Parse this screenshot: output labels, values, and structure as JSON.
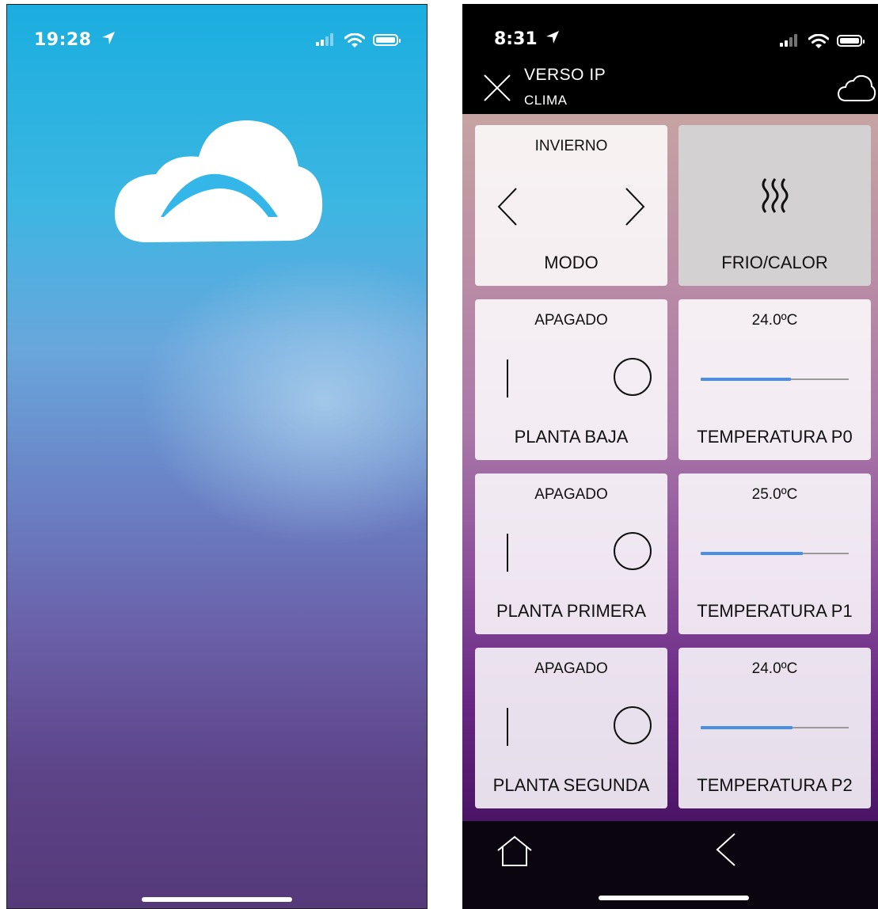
{
  "left_screen": {
    "status_bar": {
      "time": "19:28"
    }
  },
  "right_screen": {
    "status_bar": {
      "time": "8:31"
    },
    "header": {
      "title": "VERSO IP",
      "subtitle": "CLIMA"
    },
    "tiles": [
      {
        "top": "INVIERNO",
        "bottom": "MODO",
        "kind": "mode"
      },
      {
        "top": "",
        "bottom": "FRIO/CALOR",
        "kind": "heat",
        "icon": "heat-waves-icon"
      },
      {
        "top": "APAGADO",
        "bottom": "PLANTA BAJA",
        "kind": "switch"
      },
      {
        "top": "24.0ºC",
        "bottom": "TEMPERATURA P0",
        "kind": "slider",
        "level": 0.61
      },
      {
        "top": "APAGADO",
        "bottom": "PLANTA PRIMERA",
        "kind": "switch"
      },
      {
        "top": "25.0ºC",
        "bottom": "TEMPERATURA P1",
        "kind": "slider",
        "level": 0.69
      },
      {
        "top": "APAGADO",
        "bottom": "PLANTA SEGUNDA",
        "kind": "switch"
      },
      {
        "top": "24.0ºC",
        "bottom": "TEMPERATURA P2",
        "kind": "slider",
        "level": 0.62
      }
    ]
  },
  "colors": {
    "accent_blue": "#4a8fe7",
    "splash_top": "#1aaedf",
    "splash_bottom": "#55397a"
  }
}
